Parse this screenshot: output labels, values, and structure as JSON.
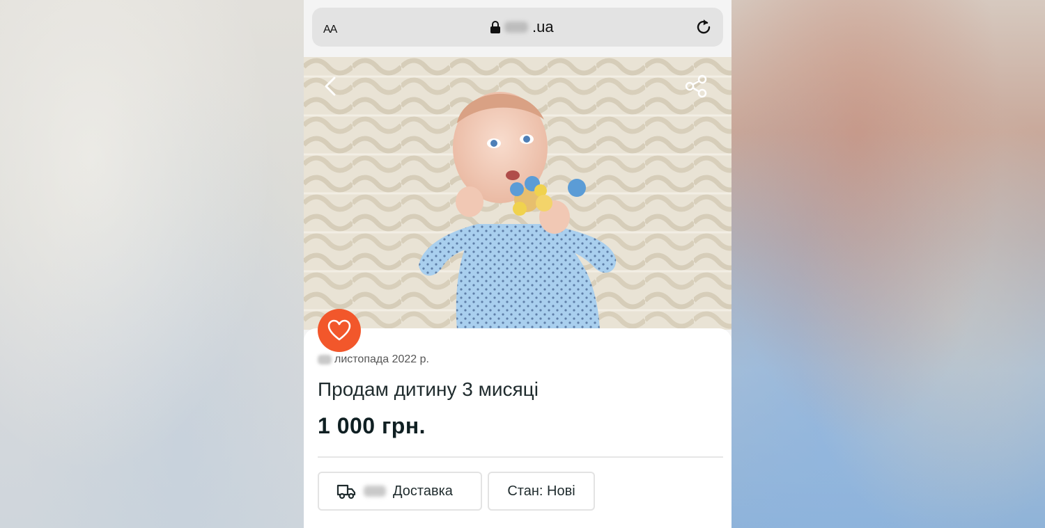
{
  "browser": {
    "text_size_label": "AA",
    "domain_suffix": ".ua",
    "icons": [
      "lock-icon",
      "reload-icon"
    ]
  },
  "listing": {
    "image_icons": [
      "back-chevron-icon",
      "share-icon"
    ],
    "favorite_icon": "heart-icon",
    "date_text": "листопада 2022 р.",
    "title": "Продам дитину 3 мисяці",
    "price": "1 000 грн.",
    "delivery_label": "Доставка",
    "condition_label": "Стан: Нові"
  },
  "colors": {
    "accent": "#f2572b",
    "text_dark": "#0f1f22",
    "text_secondary": "#555555",
    "card_bg": "#ffffff",
    "urlbar_bg": "#e3e3e3"
  }
}
